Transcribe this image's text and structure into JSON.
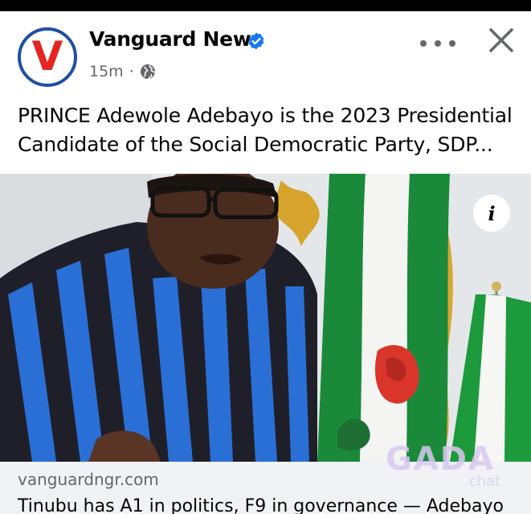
{
  "post": {
    "page_name": "Vanguard News",
    "avatar_letter": "V",
    "time": "15m",
    "separator": "·",
    "caption_line1": "PRINCE Adewole Adebayo is the 2023 Presidential",
    "caption_line2": "Candidate of the Social Democratic Party, SDP...",
    "info_symbol": "i"
  },
  "link_preview": {
    "domain": "vanguardngr.com",
    "headline": "Tinubu has A1 in politics, F9 in governance — Adebayo"
  },
  "watermark": {
    "main": "GADA",
    "sub": ".chat"
  },
  "icons": [
    "verified-badge-icon",
    "globe-icon",
    "more-options-icon",
    "close-icon",
    "info-icon"
  ],
  "colors": {
    "brand_blue": "#1f4fa3",
    "brand_red": "#e52521",
    "verified_blue": "#1877f2",
    "secondary_text": "#65676b",
    "footer_bg": "#f0f2f5"
  }
}
